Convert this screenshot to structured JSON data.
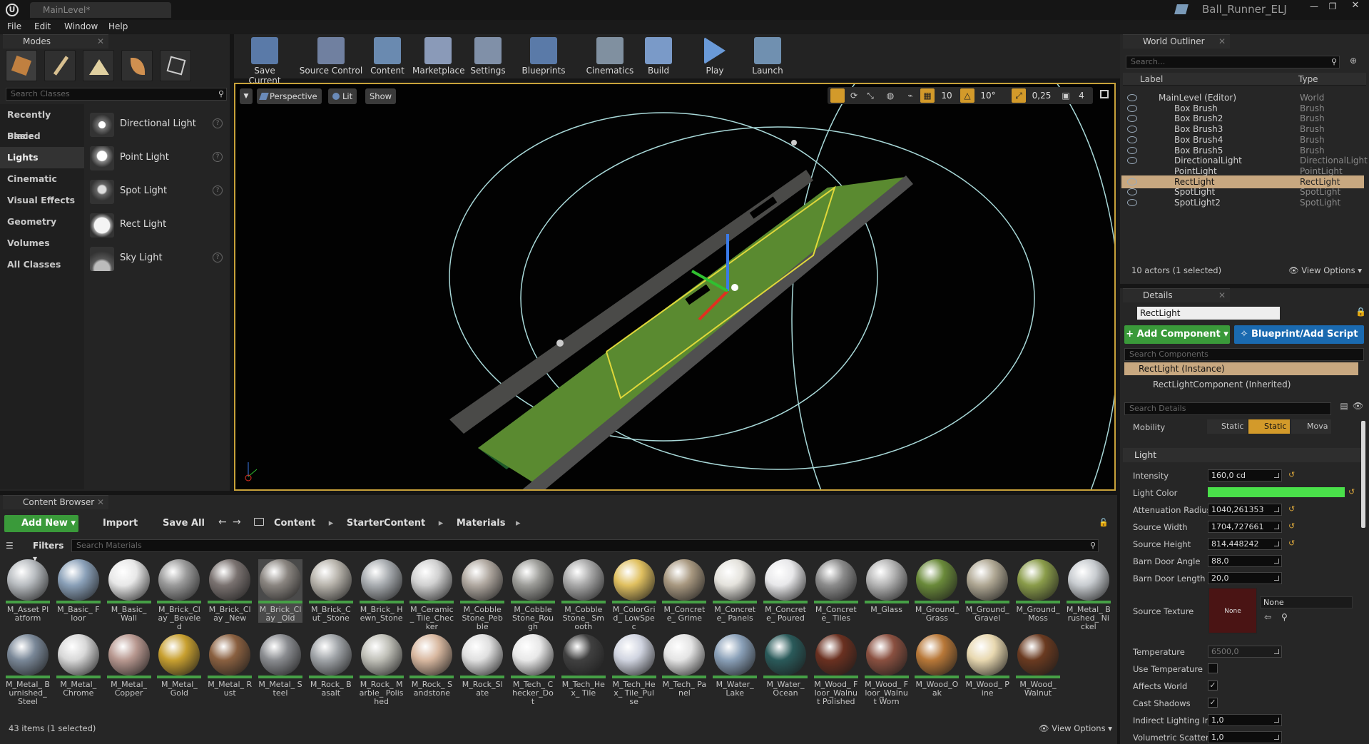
{
  "window": {
    "tab_title": "MainLevel*",
    "project_name": "Ball_Runner_ELJ"
  },
  "menu": [
    "File",
    "Edit",
    "Window",
    "Help"
  ],
  "modes": {
    "tab": "Modes",
    "search_placeholder": "Search Classes",
    "categories": [
      "Recently Placed",
      "Basic",
      "Lights",
      "Cinematic",
      "Visual Effects",
      "Geometry",
      "Volumes",
      "All Classes"
    ],
    "selected_category": "Lights",
    "classes": [
      {
        "label": "Directional Light",
        "icon": "directional-light-icon"
      },
      {
        "label": "Point Light",
        "icon": "point-light-icon"
      },
      {
        "label": "Spot Light",
        "icon": "spot-light-icon"
      },
      {
        "label": "Rect Light",
        "icon": "rect-light-icon"
      },
      {
        "label": "Sky Light",
        "icon": "sky-light-icon"
      }
    ]
  },
  "toolbar": [
    {
      "label": "Save Current",
      "icon": "save-icon"
    },
    {
      "label": "Source Control",
      "icon": "source-control-icon"
    },
    {
      "label": "Content",
      "icon": "content-icon"
    },
    {
      "label": "Marketplace",
      "icon": "marketplace-icon"
    },
    {
      "label": "Settings",
      "icon": "settings-icon"
    },
    {
      "label": "Blueprints",
      "icon": "blueprints-icon"
    },
    {
      "label": "Cinematics",
      "icon": "cinematics-icon"
    },
    {
      "label": "Build",
      "icon": "build-icon"
    },
    {
      "label": "Play",
      "icon": "play-icon"
    },
    {
      "label": "Launch",
      "icon": "launch-icon"
    }
  ],
  "viewport": {
    "perspective": "Perspective",
    "lit": "Lit",
    "show": "Show",
    "grid_snap": "10",
    "rot_snap": "10°",
    "scale_snap": "0,25",
    "cam_speed": "4"
  },
  "outliner": {
    "tab": "World Outliner",
    "search_placeholder": "Search...",
    "col_label": "Label",
    "col_type": "Type",
    "rows": [
      {
        "label": "MainLevel (Editor)",
        "type": "World"
      },
      {
        "label": "Box Brush",
        "type": "Brush"
      },
      {
        "label": "Box Brush2",
        "type": "Brush"
      },
      {
        "label": "Box Brush3",
        "type": "Brush"
      },
      {
        "label": "Box Brush4",
        "type": "Brush"
      },
      {
        "label": "Box Brush5",
        "type": "Brush"
      },
      {
        "label": "DirectionalLight",
        "type": "DirectionalLight"
      },
      {
        "label": "PointLight",
        "type": "PointLight"
      },
      {
        "label": "RectLight",
        "type": "RectLight"
      },
      {
        "label": "SpotLight",
        "type": "SpotLight"
      },
      {
        "label": "SpotLight2",
        "type": "SpotLight"
      }
    ],
    "selected": "RectLight",
    "status": "10 actors (1 selected)",
    "view_options": "View Options"
  },
  "details": {
    "tab": "Details",
    "name": "RectLight",
    "add_component": "+ Add Component",
    "blueprint": "Blueprint/Add Script",
    "search_components": "Search Components",
    "instance": "RectLight (Instance)",
    "component": "RectLightComponent (Inherited)",
    "search_details": "Search Details",
    "mobility_label": "Mobility",
    "mobility": [
      "Static",
      "Static",
      "Mova"
    ],
    "section": "Light",
    "props": [
      {
        "label": "Intensity",
        "value": "160,0 cd"
      },
      {
        "label": "Light Color",
        "value": ""
      },
      {
        "label": "Attenuation Radius",
        "value": "1040,261353"
      },
      {
        "label": "Source Width",
        "value": "1704,727661"
      },
      {
        "label": "Source Height",
        "value": "814,448242"
      },
      {
        "label": "Barn Door Angle",
        "value": "88,0"
      },
      {
        "label": "Barn Door Length",
        "value": "20,0"
      }
    ],
    "source_texture_label": "Source Texture",
    "source_texture_value": "None",
    "source_texture_thumb": "None",
    "props2": [
      {
        "label": "Temperature",
        "value": "6500,0"
      },
      {
        "label": "Use Temperature",
        "value": ""
      },
      {
        "label": "Affects World",
        "value": "✓"
      },
      {
        "label": "Cast Shadows",
        "value": "✓"
      },
      {
        "label": "Indirect Lighting Int",
        "value": "1,0"
      },
      {
        "label": "Volumetric Scatteri",
        "value": "1,0"
      }
    ]
  },
  "content_browser": {
    "tab": "Content Browser",
    "add_new": "Add New",
    "import": "Import",
    "save_all": "Save All",
    "path": [
      "Content",
      "StarterContent",
      "Materials"
    ],
    "filters": "Filters",
    "search_placeholder": "Search Materials",
    "status": "43 items (1 selected)",
    "view_options": "View Options",
    "row1": [
      {
        "l": "M_Asset Platform",
        "c": "#b8bcc0"
      },
      {
        "l": "M_Basic_ Floor",
        "c": "#8aa0b8"
      },
      {
        "l": "M_Basic_ Wall",
        "c": "#e8e8e8"
      },
      {
        "l": "M_Brick_Clay _Beveled",
        "c": "#9a9a9a"
      },
      {
        "l": "M_Brick_Clay _New",
        "c": "#7a7270"
      },
      {
        "l": "M_Brick_Clay _Old",
        "c": "#8a8580"
      },
      {
        "l": "M_Brick_Cut _Stone",
        "c": "#b8b4ac"
      },
      {
        "l": "M_Brick_ Hewn_Stone",
        "c": "#a8acb0"
      },
      {
        "l": "M_Ceramic_ Tile_Checker",
        "c": "#d0d0d0"
      },
      {
        "l": "M_Cobble Stone_Pebble",
        "c": "#b0a8a0"
      },
      {
        "l": "M_Cobble Stone_Rough",
        "c": "#9c9c98"
      },
      {
        "l": "M_Cobble Stone_ Smooth",
        "c": "#a8a8a8"
      },
      {
        "l": "M_ColorGrid_ LowSpec",
        "c": "#e0c060"
      },
      {
        "l": "M_Concrete_ Grime",
        "c": "#a89880"
      },
      {
        "l": "M_Concrete_ Panels",
        "c": "#e4e2dc"
      },
      {
        "l": "M_Concrete_ Poured",
        "c": "#e8e8ea"
      },
      {
        "l": "M_Concrete_ Tiles",
        "c": "#8c8c8c"
      },
      {
        "l": "M_Glass",
        "c": "#b4b4b4"
      },
      {
        "l": "M_Ground_ Grass",
        "c": "#6a8a3a"
      },
      {
        "l": "M_Ground_ Gravel",
        "c": "#b0a894"
      },
      {
        "l": "M_Ground_ Moss",
        "c": "#8a9c4a"
      },
      {
        "l": "M_Metal_ Brushed_ Nickel",
        "c": "#c8ccd0"
      }
    ],
    "row2": [
      {
        "l": "M_Metal_ Burnished_ Steel",
        "c": "#7a8898"
      },
      {
        "l": "M_Metal_ Chrome",
        "c": "#d8d8d8"
      },
      {
        "l": "M_Metal_ Copper",
        "c": "#b89890"
      },
      {
        "l": "M_Metal_ Gold",
        "c": "#c8a030"
      },
      {
        "l": "M_Metal_ Rust",
        "c": "#8a6040"
      },
      {
        "l": "M_Metal_ Steel",
        "c": "#8a8c90"
      },
      {
        "l": "M_Rock_ Basalt",
        "c": "#a0a4a8"
      },
      {
        "l": "M_Rock_ Marble_ Polished",
        "c": "#c0c0b8"
      },
      {
        "l": "M_Rock_ Sandstone",
        "c": "#d8b8a0"
      },
      {
        "l": "M_Rock_Slate",
        "c": "#e0e0e0"
      },
      {
        "l": "M_Tech_ Checker_Dot",
        "c": "#e8e8e8"
      },
      {
        "l": "M_Tech_Hex_ Tile",
        "c": "#404040"
      },
      {
        "l": "M_Tech_Hex_ Tile_Pulse",
        "c": "#d0d4e0"
      },
      {
        "l": "M_Tech_ Panel",
        "c": "#e4e4e4"
      },
      {
        "l": "M_Water_ Lake",
        "c": "#8aa0b8"
      },
      {
        "l": "M_Water_ Ocean",
        "c": "#2a5a5a"
      },
      {
        "l": "M_Wood_ Floor_Walnut Polished",
        "c": "#6a3020"
      },
      {
        "l": "M_Wood_ Floor_Walnut Worn",
        "c": "#8a5040"
      },
      {
        "l": "M_Wood_Oak",
        "c": "#b87838"
      },
      {
        "l": "M_Wood_ Pine",
        "c": "#e8d8b0"
      },
      {
        "l": "M_Wood_ Walnut",
        "c": "#6a3a20"
      }
    ]
  }
}
